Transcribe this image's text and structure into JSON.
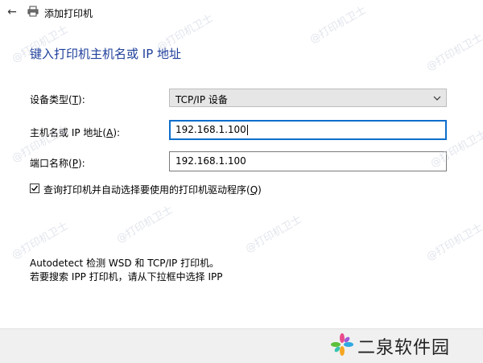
{
  "window": {
    "title": "添加打印机"
  },
  "heading": "键入打印机主机名或 IP 地址",
  "form": {
    "device_type": {
      "label_prefix": "设备类型(",
      "hotkey": "T",
      "label_suffix": "):",
      "value": "TCP/IP 设备"
    },
    "host": {
      "label_prefix": "主机名或 IP 地址(",
      "hotkey": "A",
      "label_suffix": "):",
      "value": "192.168.1.100"
    },
    "port": {
      "label_prefix": "端口名称(",
      "hotkey": "P",
      "label_suffix": "):",
      "value": "192.168.1.100"
    },
    "query_checkbox": {
      "checked": true,
      "label_prefix": "查询打印机并自动选择要使用的打印机驱动程序(",
      "hotkey": "Q",
      "label_suffix": ")"
    }
  },
  "info": {
    "line1": "Autodetect 检测 WSD 和 TCP/IP 打印机。",
    "line2": "若要搜索 IPP 打印机，请从下拉框中选择 IPP"
  },
  "watermark": "@打印机卫士",
  "brand": {
    "text": "二泉软件园"
  },
  "colors": {
    "heading": "#1f3f9b",
    "focus": "#0d6ecb",
    "footer": "#f0f0f0"
  }
}
